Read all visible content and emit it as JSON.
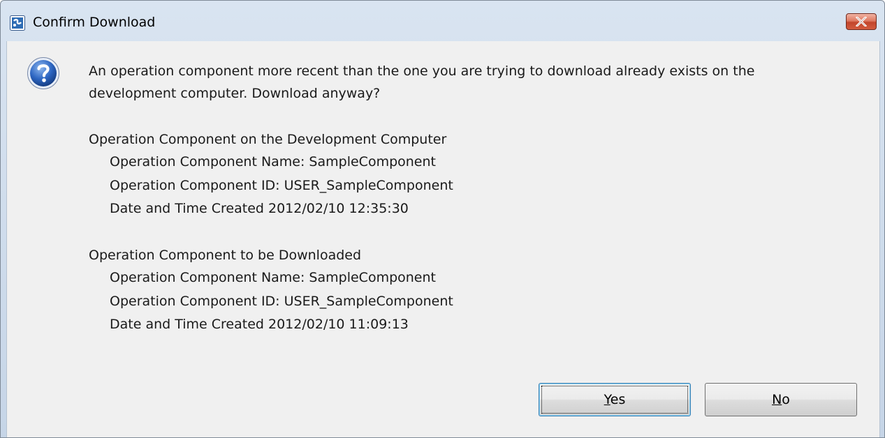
{
  "window": {
    "title": "Confirm Download",
    "icon": "app-icon",
    "close_icon": "close-icon"
  },
  "dialog": {
    "icon": "question-icon",
    "message_line1": "An operation component more recent than the one you are trying to download already exists on the",
    "message_line2": "development computer. Download anyway?",
    "dev_section": {
      "heading": "Operation Component on the Development Computer",
      "name": "Operation Component Name: SampleComponent",
      "id": "Operation Component ID: USER_SampleComponent",
      "created": "Date and Time Created 2012/02/10 12:35:30"
    },
    "download_section": {
      "heading": "Operation Component to be Downloaded",
      "name": "Operation Component Name: SampleComponent",
      "id": "Operation Component ID: USER_SampleComponent",
      "created": "Date and Time Created 2012/02/10 11:09:13"
    }
  },
  "buttons": {
    "yes_mnemonic": "Y",
    "yes_rest": "es",
    "no_mnemonic": "N",
    "no_rest": "o"
  },
  "colors": {
    "title_bar": "#c6d5e7",
    "close_button": "#c2452b",
    "client_background": "#f0f0f0",
    "default_button_border": "#3c7fb1"
  }
}
